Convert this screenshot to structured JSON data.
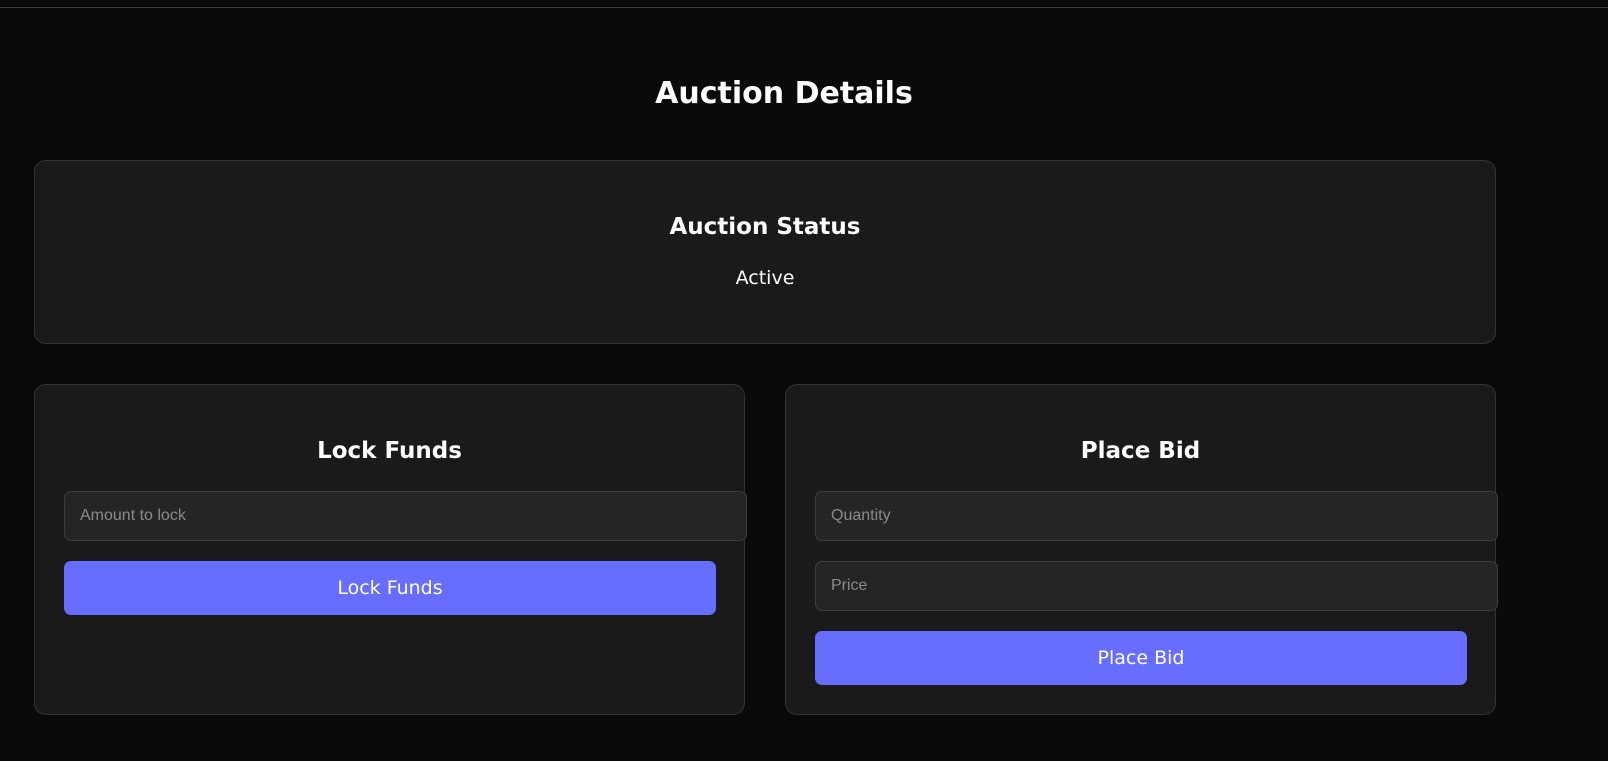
{
  "page": {
    "title": "Auction Details"
  },
  "status": {
    "title": "Auction Status",
    "value": "Active"
  },
  "lock_funds": {
    "title": "Lock Funds",
    "amount_placeholder": "Amount to lock",
    "amount_value": "",
    "button_label": "Lock Funds"
  },
  "place_bid": {
    "title": "Place Bid",
    "quantity_placeholder": "Quantity",
    "quantity_value": "",
    "price_placeholder": "Price",
    "price_value": "",
    "button_label": "Place Bid"
  },
  "colors": {
    "background": "#0a0a0a",
    "card": "#1a1a1a",
    "accent": "#676dff"
  }
}
